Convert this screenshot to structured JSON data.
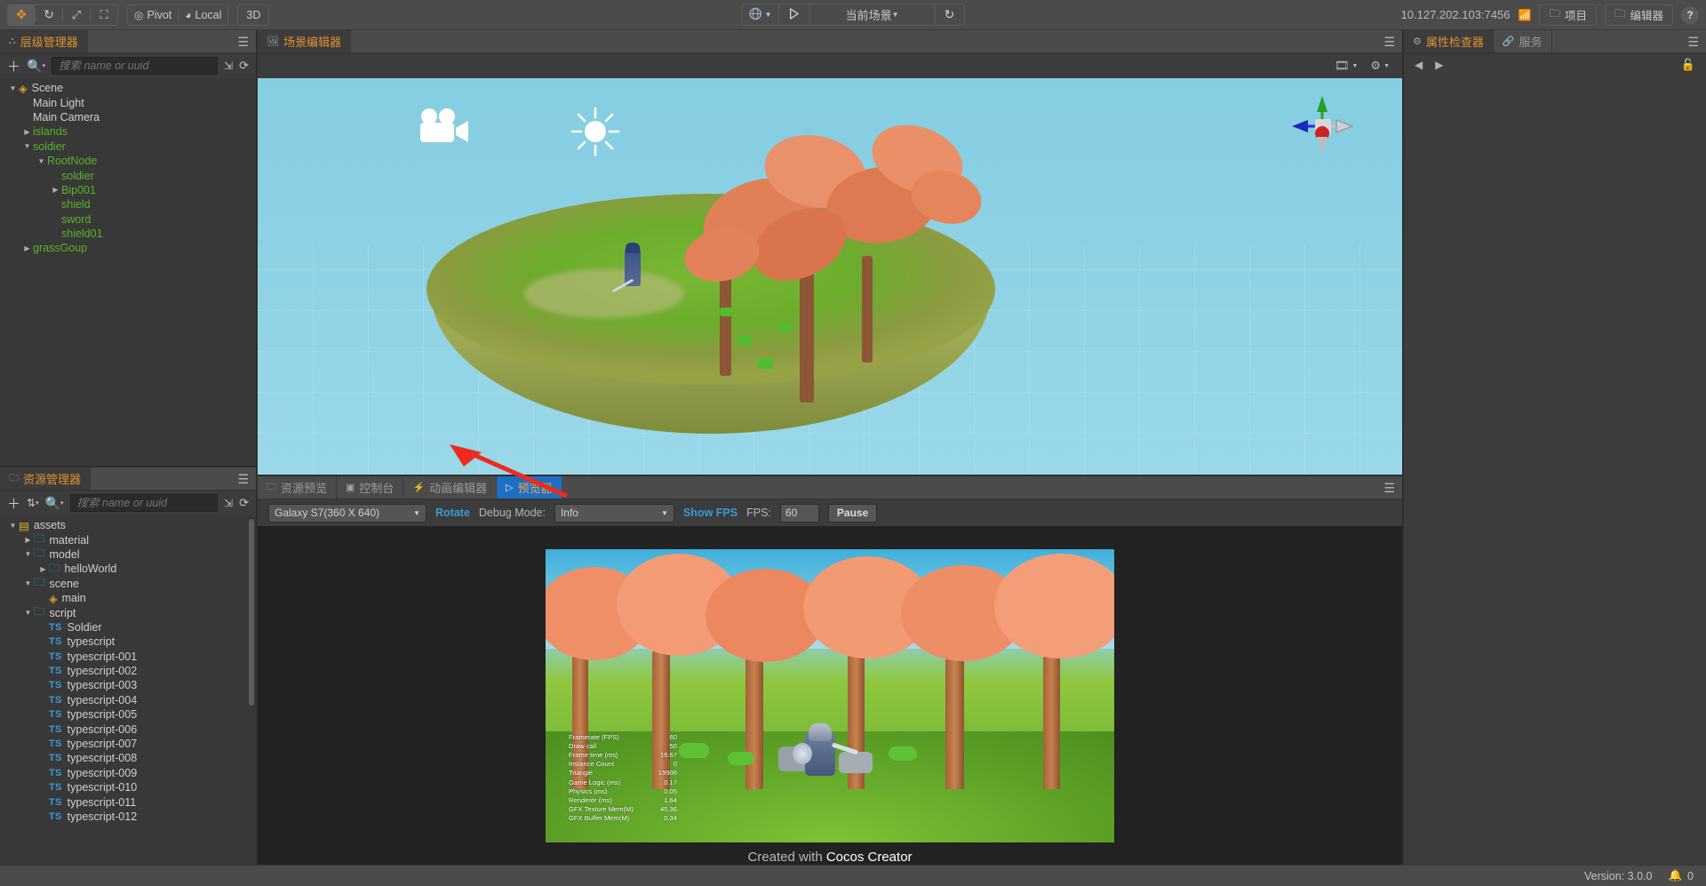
{
  "toolbar": {
    "transform_tools": [
      {
        "name": "move-tool",
        "glyph": "✥",
        "active": true
      },
      {
        "name": "rotate-tool",
        "glyph": "↻",
        "active": false
      },
      {
        "name": "scale-tool",
        "glyph": "⤧",
        "active": false
      },
      {
        "name": "rect-tool",
        "glyph": "▢",
        "active": false
      }
    ],
    "pivot_label": "Pivot",
    "coord_label": "Local",
    "dimension_label": "3D",
    "globe_icon": "globe-icon",
    "play_icon": "play-icon",
    "scene_selector_value": "当前场景",
    "refresh_icon": "refresh-icon",
    "server_address": "10.127.202.103:7456",
    "wifi_icon": "wifi-icon",
    "project_button": "项目",
    "editor_button": "编辑器",
    "help_button": "?"
  },
  "hierarchy": {
    "tab_label": "层级管理器",
    "search_placeholder": "搜索 name or uuid",
    "add_icon": "plus-icon",
    "filter_icon": "search-filter-icon",
    "collapse_icon": "collapse-icon",
    "refresh_icon": "refresh-icon",
    "menu_icon": "hamburger-icon",
    "nodes": [
      {
        "label": "Scene",
        "depth": 0,
        "twisty": "down",
        "icon": "scene-flame",
        "color": "default"
      },
      {
        "label": "Main Light",
        "depth": 1,
        "twisty": "none",
        "icon": "none",
        "color": "default"
      },
      {
        "label": "Main Camera",
        "depth": 1,
        "twisty": "none",
        "icon": "none",
        "color": "default"
      },
      {
        "label": "islands",
        "depth": 1,
        "twisty": "right",
        "icon": "none",
        "color": "green"
      },
      {
        "label": "soldier",
        "depth": 1,
        "twisty": "down",
        "icon": "none",
        "color": "green"
      },
      {
        "label": "RootNode",
        "depth": 2,
        "twisty": "down",
        "icon": "none",
        "color": "green"
      },
      {
        "label": "soldier",
        "depth": 3,
        "twisty": "none",
        "icon": "none",
        "color": "green"
      },
      {
        "label": "Bip001",
        "depth": 3,
        "twisty": "right",
        "icon": "none",
        "color": "green"
      },
      {
        "label": "shield",
        "depth": 3,
        "twisty": "none",
        "icon": "none",
        "color": "green"
      },
      {
        "label": "sword",
        "depth": 3,
        "twisty": "none",
        "icon": "none",
        "color": "green"
      },
      {
        "label": "shield01",
        "depth": 3,
        "twisty": "none",
        "icon": "none",
        "color": "green"
      },
      {
        "label": "grassGoup",
        "depth": 1,
        "twisty": "right",
        "icon": "none",
        "color": "green"
      }
    ]
  },
  "assets": {
    "tab_label": "资源管理器",
    "search_placeholder": "搜索 name or uuid",
    "add_icon": "plus-icon",
    "sort_icon": "sort-icon",
    "filter_icon": "search-filter-icon",
    "collapse_icon": "collapse-icon",
    "refresh_icon": "refresh-icon",
    "menu_icon": "hamburger-icon",
    "nodes": [
      {
        "label": "assets",
        "depth": 0,
        "twisty": "down",
        "icon": "db"
      },
      {
        "label": "material",
        "depth": 1,
        "twisty": "right",
        "icon": "folder"
      },
      {
        "label": "model",
        "depth": 1,
        "twisty": "down",
        "icon": "folder"
      },
      {
        "label": "helloWorld",
        "depth": 2,
        "twisty": "right",
        "icon": "folder"
      },
      {
        "label": "scene",
        "depth": 1,
        "twisty": "down",
        "icon": "folder"
      },
      {
        "label": "main",
        "depth": 2,
        "twisty": "none",
        "icon": "scene-flame"
      },
      {
        "label": "script",
        "depth": 1,
        "twisty": "down",
        "icon": "folder"
      },
      {
        "label": "Soldier",
        "depth": 2,
        "twisty": "none",
        "icon": "ts"
      },
      {
        "label": "typescript",
        "depth": 2,
        "twisty": "none",
        "icon": "ts"
      },
      {
        "label": "typescript-001",
        "depth": 2,
        "twisty": "none",
        "icon": "ts"
      },
      {
        "label": "typescript-002",
        "depth": 2,
        "twisty": "none",
        "icon": "ts"
      },
      {
        "label": "typescript-003",
        "depth": 2,
        "twisty": "none",
        "icon": "ts"
      },
      {
        "label": "typescript-004",
        "depth": 2,
        "twisty": "none",
        "icon": "ts"
      },
      {
        "label": "typescript-005",
        "depth": 2,
        "twisty": "none",
        "icon": "ts"
      },
      {
        "label": "typescript-006",
        "depth": 2,
        "twisty": "none",
        "icon": "ts"
      },
      {
        "label": "typescript-007",
        "depth": 2,
        "twisty": "none",
        "icon": "ts"
      },
      {
        "label": "typescript-008",
        "depth": 2,
        "twisty": "none",
        "icon": "ts"
      },
      {
        "label": "typescript-009",
        "depth": 2,
        "twisty": "none",
        "icon": "ts"
      },
      {
        "label": "typescript-010",
        "depth": 2,
        "twisty": "none",
        "icon": "ts"
      },
      {
        "label": "typescript-011",
        "depth": 2,
        "twisty": "none",
        "icon": "ts"
      },
      {
        "label": "typescript-012",
        "depth": 2,
        "twisty": "none",
        "icon": "ts"
      }
    ]
  },
  "scene_panel": {
    "tab_label": "场景编辑器",
    "tab_icon": "image-icon",
    "menu_icon": "hamburger-icon",
    "camera_icon": "camera-gizmo-icon",
    "gear_icon": "gear-icon",
    "gizmo_camera_label": "camera-icon",
    "gizmo_light_label": "sun-icon",
    "axis_gizmo_label": "axis-gizmo"
  },
  "bottom_panel": {
    "tabs": [
      {
        "label": "资源预览",
        "icon": "folder-icon",
        "state": "normal"
      },
      {
        "label": "控制台",
        "icon": "console-icon",
        "state": "normal"
      },
      {
        "label": "动画编辑器",
        "icon": "anim-icon",
        "state": "normal"
      },
      {
        "label": "预览器",
        "icon": "preview-icon",
        "state": "active"
      }
    ],
    "menu_icon": "hamburger-icon",
    "toolbar": {
      "device_value": "Galaxy S7(360 X 640)",
      "rotate_label": "Rotate",
      "debug_mode_label": "Debug Mode:",
      "debug_mode_value": "Info",
      "show_fps_label": "Show FPS",
      "fps_label": "FPS:",
      "fps_value": "60",
      "pause_label": "Pause"
    },
    "stats": [
      {
        "label": "Framerate (FPS)",
        "value": "60"
      },
      {
        "label": "Draw call",
        "value": "50"
      },
      {
        "label": "Frame time (ms)",
        "value": "16.67"
      },
      {
        "label": "Instance Count",
        "value": "0"
      },
      {
        "label": "Triangle",
        "value": "19906"
      },
      {
        "label": "Game Logic (ms)",
        "value": "0.17"
      },
      {
        "label": "Physics (ms)",
        "value": "0.05"
      },
      {
        "label": "Renderer (ms)",
        "value": "1.64"
      },
      {
        "label": "GFX Texture Mem(M)",
        "value": "45.36"
      },
      {
        "label": "GFX Buffer Mem(M)",
        "value": "0.34"
      }
    ],
    "created_with_prefix": "Created with ",
    "created_with_brand": "Cocos Creator"
  },
  "inspector": {
    "tabs": [
      {
        "label": "属性检查器",
        "icon": "gear-icon",
        "state": "active"
      },
      {
        "label": "服务",
        "icon": "link-icon",
        "state": "normal"
      }
    ],
    "menu_icon": "hamburger-icon",
    "back_icon": "chevron-left-icon",
    "forward_icon": "chevron-right-icon",
    "lock_icon": "lock-open-icon"
  },
  "statusbar": {
    "version_label": "Version: 3.0.0",
    "bell_icon": "bell-icon",
    "notification_count": "0"
  },
  "colors": {
    "accent_orange": "#e0902e",
    "accent_blue": "#1d6fc4",
    "tree_green": "#5ab32a",
    "ts_blue": "#3a9ad9",
    "panel_bg": "#3c3c3c",
    "chrome_bg": "#4b4b4b",
    "annotation_red": "#ee2a1e"
  }
}
